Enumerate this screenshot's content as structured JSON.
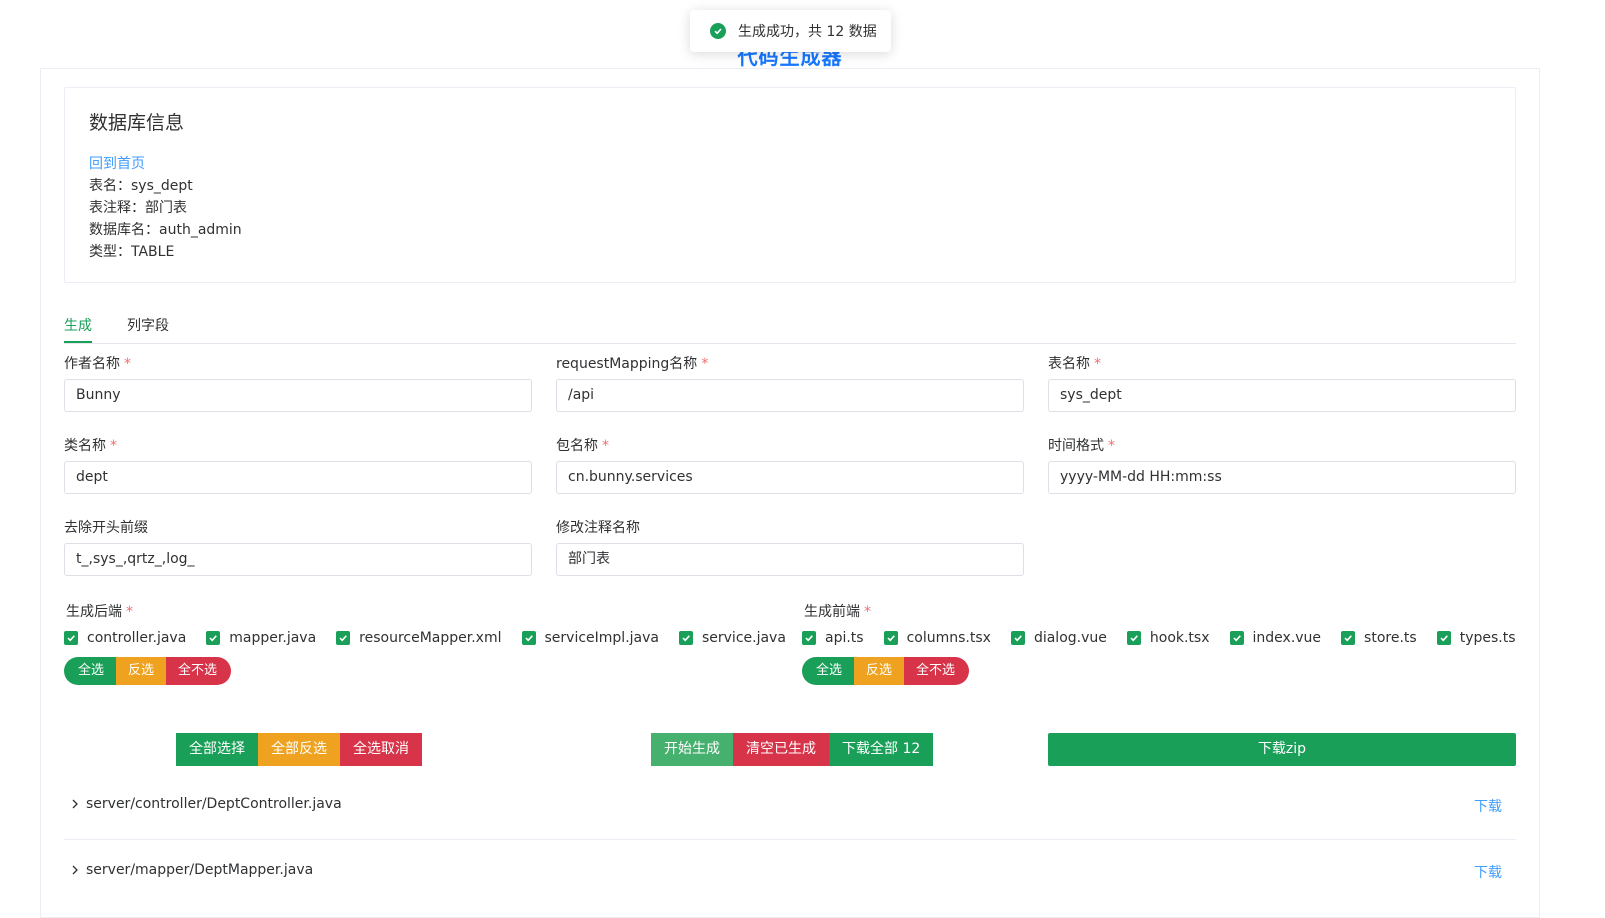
{
  "page_title": "代码生成器",
  "toast": {
    "message": "生成成功，共 12 数据"
  },
  "info": {
    "heading": "数据库信息",
    "home_link": "回到首页",
    "table_name": "表名：sys_dept",
    "table_comment": "表注释：部门表",
    "db_name": "数据库名：auth_admin",
    "type": "类型：TABLE"
  },
  "tabs": [
    {
      "label": "生成",
      "active": true
    },
    {
      "label": "列字段",
      "active": false
    }
  ],
  "form": {
    "author": {
      "label": "作者名称",
      "value": "Bunny"
    },
    "request_mapping": {
      "label": "requestMapping名称",
      "value": "/api"
    },
    "table_name": {
      "label": "表名称",
      "value": "sys_dept"
    },
    "class_name": {
      "label": "类名称",
      "value": "dept"
    },
    "package_name": {
      "label": "包名称",
      "value": "cn.bunny.services"
    },
    "time_format": {
      "label": "时间格式",
      "value": "yyyy-MM-dd HH:mm:ss"
    },
    "prefix": {
      "label": "去除开头前缀",
      "value": "t_,sys_,qrtz_,log_"
    },
    "comment": {
      "label": "修改注释名称",
      "value": "部门表"
    },
    "required_mark": "*"
  },
  "backend": {
    "label": "生成后端",
    "options": [
      "controller.java",
      "mapper.java",
      "resourceMapper.xml",
      "serviceImpl.java",
      "service.java"
    ],
    "select_all": "全选",
    "invert": "反选",
    "select_none": "全不选"
  },
  "frontend": {
    "label": "生成前端",
    "options": [
      "api.ts",
      "columns.tsx",
      "dialog.vue",
      "hook.tsx",
      "index.vue",
      "store.ts",
      "types.ts"
    ],
    "select_all": "全选",
    "invert": "反选",
    "select_none": "全不选"
  },
  "actions": {
    "all_select": "全部选择",
    "all_invert": "全部反选",
    "all_cancel": "全选取消",
    "start": "开始生成",
    "clear": "清空已生成",
    "download_all": "下载全部 12",
    "download_zip": "下载zip"
  },
  "files": [
    {
      "path": "server/controller/DeptController.java",
      "action": "下载"
    },
    {
      "path": "server/mapper/DeptMapper.java",
      "action": "下载"
    }
  ],
  "colors": {
    "primary": "#1a9f58",
    "warning": "#eea21f",
    "danger": "#d73349",
    "link": "#409eff"
  }
}
